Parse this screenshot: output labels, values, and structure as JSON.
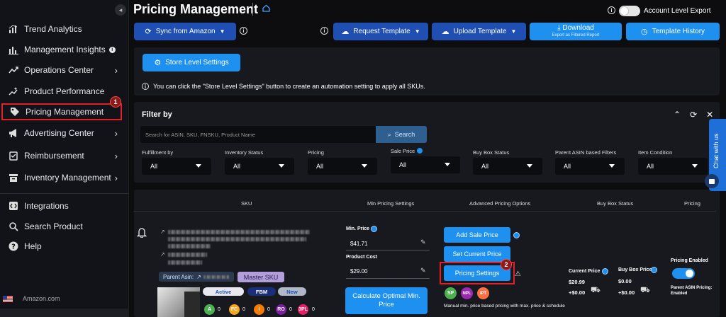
{
  "sidebar": {
    "items": [
      {
        "label": "Trend Analytics",
        "icon": "analytics-icon",
        "chev": false
      },
      {
        "label": "Management Insights",
        "icon": "bar-chart-icon",
        "chev": false,
        "info": true
      },
      {
        "label": "Operations Center",
        "icon": "trend-line-icon",
        "chev": true
      },
      {
        "label": "Product Performance",
        "icon": "sparkle-chart-icon",
        "chev": false
      },
      {
        "label": "Pricing Management",
        "icon": "tag-icon",
        "chev": false,
        "active": true
      },
      {
        "label": "Advertising Center",
        "icon": "megaphone-icon",
        "chev": true
      },
      {
        "label": "Reimbursement",
        "icon": "clipboard-icon",
        "chev": true
      },
      {
        "label": "Inventory Management",
        "icon": "archive-icon",
        "chev": true
      },
      {
        "label": "Integrations",
        "icon": "integrations-icon",
        "chev": false
      },
      {
        "label": "Search Product",
        "icon": "search-icon",
        "chev": false
      },
      {
        "label": "Help",
        "icon": "help-icon",
        "chev": false
      }
    ],
    "active_step": "1",
    "store": "Amazon.com"
  },
  "header": {
    "title": "Pricing Management",
    "account_export_label": "Account Level Export"
  },
  "toolbar": {
    "sync_label": "Sync from Amazon",
    "request_template_label": "Request Template",
    "upload_template_label": "Upload Template",
    "download_label": "Download",
    "download_sub": "Export as Filtered Report",
    "template_history_label": "Template History"
  },
  "store_settings": {
    "button_label": "Store Level Settings",
    "hint": "You can click the \"Store Level Settings\" button to create an automation setting to apply all SKUs."
  },
  "filter": {
    "title": "Filter by",
    "search_placeholder": "Search for ASIN, SKU, FNSKU, Product Name",
    "search_button": "Search",
    "fields": [
      {
        "label": "Fulfillment by",
        "value": "All"
      },
      {
        "label": "Inventory Status",
        "value": "All"
      },
      {
        "label": "Pricing",
        "value": "All"
      },
      {
        "label": "Sale Price",
        "value": "All",
        "info": true
      },
      {
        "label": "Buy Box Status",
        "value": "All"
      },
      {
        "label": "Parent ASIN based Filters",
        "value": "All"
      },
      {
        "label": "Item Condition",
        "value": "All"
      }
    ]
  },
  "table": {
    "headers": {
      "sku": "SKU",
      "min_pricing": "Min Pricing Settings",
      "advanced": "Advanced Pricing Options",
      "buy_box": "Buy Box Status",
      "pricing": "Pricing"
    },
    "row": {
      "parent_asin_label": "Parent Asin:",
      "master_sku": "Master SKU",
      "status_pills": [
        "Active",
        "FBM",
        "New"
      ],
      "badges": [
        {
          "code": "A",
          "count": "0",
          "color": "#4caf50"
        },
        {
          "code": "FC",
          "count": "0",
          "color": "#f5a623"
        },
        {
          "code": "I",
          "count": "0",
          "color": "#f57c00"
        },
        {
          "code": "RO",
          "count": "0",
          "color": "#7b1fa2"
        },
        {
          "code": "3PL",
          "count": "0",
          "color": "#e91e63"
        }
      ],
      "min_price_label": "Min. Price",
      "min_price": "$41.71",
      "product_cost_label": "Product Cost",
      "product_cost": "$29.00",
      "calc_button": "Calculate Optimal Min. Price",
      "add_sale_price": "Add Sale Price",
      "set_current_price": "Set Current Price",
      "pricing_settings": "Pricing Settings",
      "pricing_settings_step": "2",
      "tags": [
        {
          "code": "SP",
          "color": "#4caf50"
        },
        {
          "code": "NPL",
          "color": "#9c27b0"
        },
        {
          "code": "IPT",
          "color": "#ff7043"
        }
      ],
      "note": "Manual min. price based pricing with max. price & schedule",
      "current_price_label": "Current Price",
      "current_price": "$20.99",
      "current_shipping": "+$0.00",
      "buy_box_price_label": "Buy Box Price",
      "buy_box_price": "$0.00",
      "buy_box_shipping": "+$0.00",
      "pricing_enabled_label": "Pricing Enabled",
      "parent_asin_pricing": "Parent ASIN Pricing: Enabled"
    }
  },
  "chat": {
    "label": "Chat with us"
  },
  "colors": {
    "accent": "#1e90f0",
    "navy": "#1f4fb3",
    "highlight": "#e32027"
  }
}
